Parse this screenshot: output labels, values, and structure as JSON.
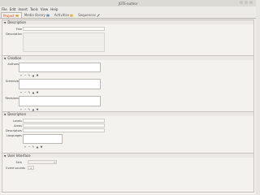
{
  "window": {
    "title": "JGTE-author"
  },
  "menu": [
    "File",
    "Edit",
    "Insert",
    "Tools",
    "View",
    "Help"
  ],
  "tabs": [
    "Project",
    "Media library",
    "Activities",
    "Sequences"
  ],
  "sections": {
    "description": {
      "title": "Description",
      "labels": [
        "Title",
        "Description"
      ]
    },
    "creation": {
      "title": "Creation",
      "labels": [
        "Authors",
        "Schedule",
        "Revisions"
      ]
    },
    "descriptors": {
      "title": "Descriptors",
      "labels": [
        "Levels",
        "Areas",
        "Descriptors",
        "Languages"
      ]
    },
    "ui": {
      "title": "User Interface",
      "labels": [
        "Skin",
        "Event sounds"
      ]
    }
  },
  "toolbar_glyphs": [
    "+",
    "−",
    "✎",
    "▲",
    "▼"
  ],
  "icons": {
    "tab_project": "folder-icon",
    "tab_media": "media-icon",
    "tab_activities": "puzzle-icon",
    "tab_sequences": "sequence-icon"
  }
}
